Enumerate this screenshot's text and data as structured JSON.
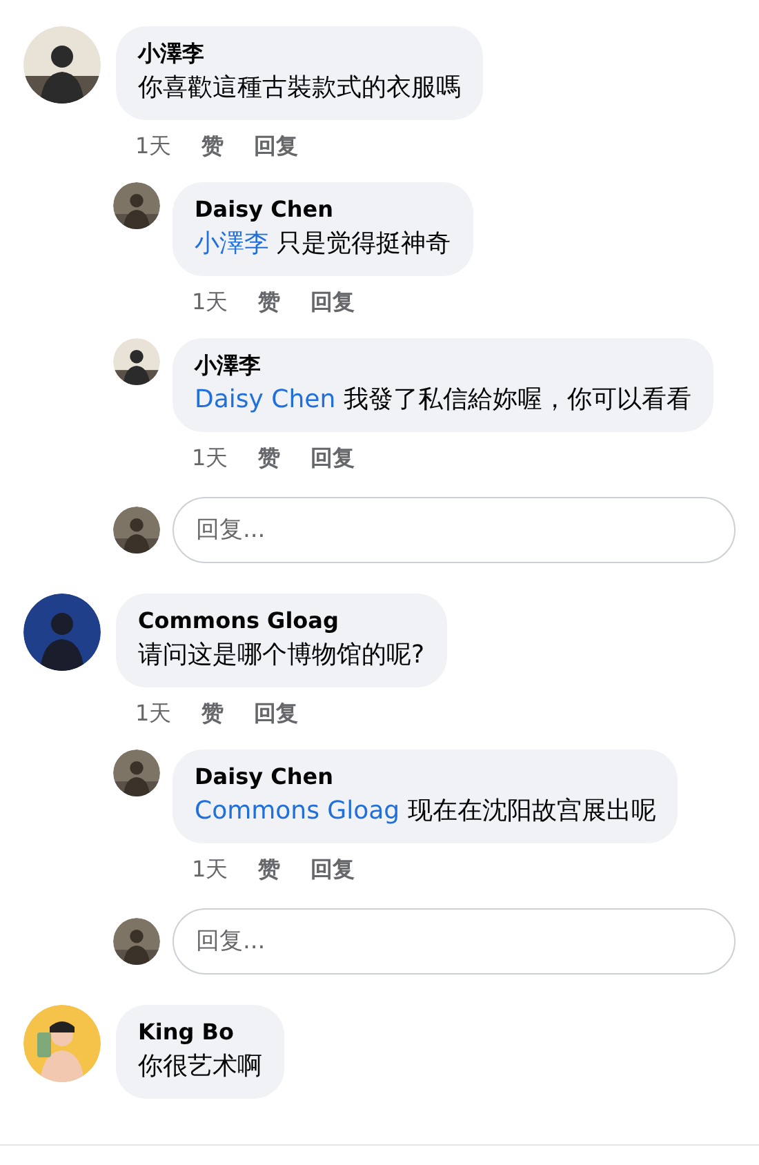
{
  "comments": [
    {
      "avatar": {
        "kind": "room"
      },
      "author": "小澤李",
      "text": "你喜歡這種古裝款式的衣服嗎",
      "time": "1天",
      "like": "赞",
      "reply": "回复",
      "replies": [
        {
          "avatar": {
            "kind": "dark"
          },
          "author": "Daisy Chen",
          "mention": "小澤李",
          "text": "只是觉得挺神奇",
          "time": "1天",
          "like": "赞",
          "reply": "回复"
        },
        {
          "avatar": {
            "kind": "room"
          },
          "author": "小澤李",
          "mention": "Daisy Chen",
          "text": "我發了私信給妳喔，你可以看看",
          "time": "1天",
          "like": "赞",
          "reply": "回复"
        }
      ],
      "reply_field": {
        "placeholder": "回复..."
      }
    },
    {
      "avatar": {
        "kind": "portrait"
      },
      "author": "Commons Gloag",
      "text": "请问这是哪个博物馆的呢?",
      "time": "1天",
      "like": "赞",
      "reply": "回复",
      "replies": [
        {
          "avatar": {
            "kind": "dark"
          },
          "author": "Daisy Chen",
          "mention": "Commons Gloag",
          "text": "现在在沈阳故宫展出呢",
          "time": "1天",
          "like": "赞",
          "reply": "回复"
        }
      ],
      "reply_field": {
        "placeholder": "回复..."
      }
    },
    {
      "avatar": {
        "kind": "cartoon"
      },
      "author": "King Bo",
      "text": "你很艺术啊"
    }
  ]
}
